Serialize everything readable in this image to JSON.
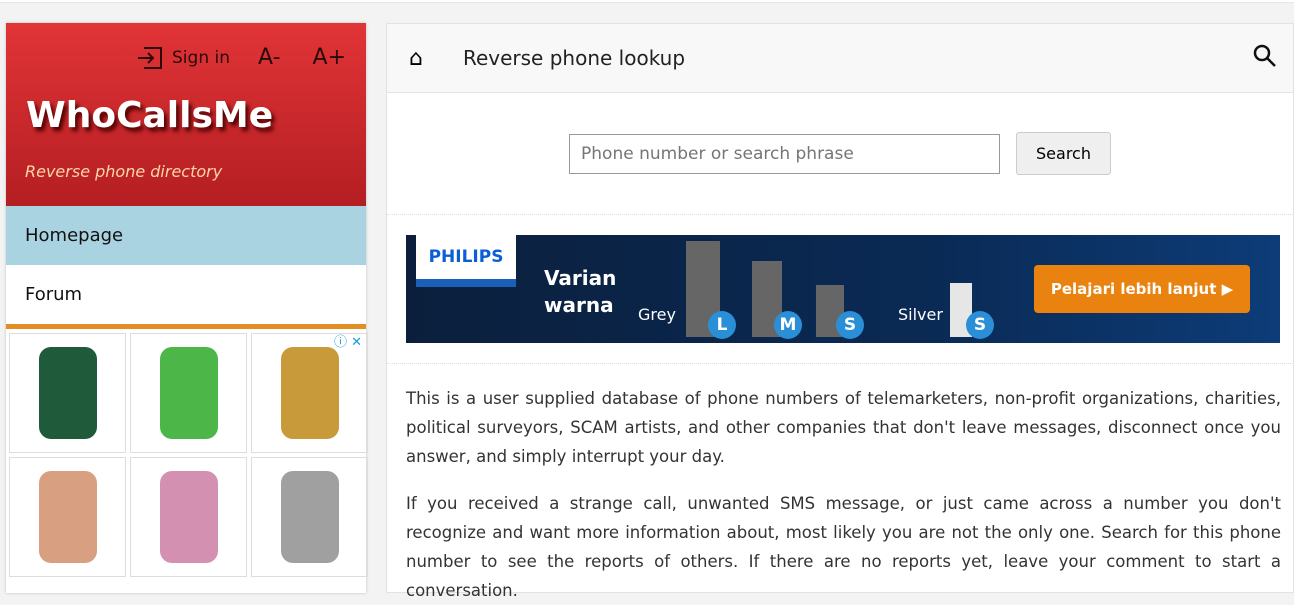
{
  "sidebar": {
    "sign_in": "Sign in",
    "font_smaller": "A-",
    "font_larger": "A+",
    "logo": "WhoCallsMe",
    "tagline": "Reverse phone directory",
    "nav": [
      {
        "label": "Homepage",
        "active": true
      },
      {
        "label": "Forum",
        "active": false
      }
    ],
    "ad_close": "ⓘ ✕",
    "ad_watches": [
      "#1f5a3a",
      "#4cb748",
      "#c89a3a",
      "#d8a080",
      "#d490b0",
      "#a0a0a0"
    ]
  },
  "header": {
    "title": "Reverse phone lookup",
    "home_icon": "home-icon",
    "search_icon": "search-icon"
  },
  "search": {
    "placeholder": "Phone number or search phrase",
    "button": "Search"
  },
  "banner": {
    "brand": "PHILIPS",
    "line1": "Varian",
    "line2": "warna",
    "grey": "Grey",
    "silver": "Silver",
    "sizes": [
      "L",
      "M",
      "S",
      "S"
    ],
    "cta": "Pelajari lebih lanjut"
  },
  "content": {
    "p1": "This is a user supplied database of phone numbers of telemarketers, non-profit organizations, charities, political surveyors, SCAM artists, and other companies that don't leave messages, disconnect once you answer, and simply interrupt your day.",
    "p2": "If you received a strange call, unwanted SMS message, or just came across a number you don't recognize and want more information about, most likely you are not the only one. Search for this phone number to see the reports of others. If there are no reports yet, leave your comment to start a conversation."
  }
}
